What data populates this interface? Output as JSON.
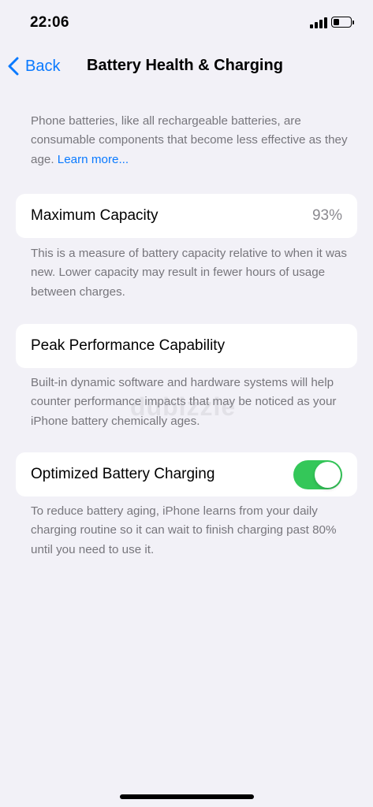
{
  "status": {
    "time": "22:06",
    "battery_level": 0.35
  },
  "nav": {
    "back_label": "Back",
    "title": "Battery Health & Charging"
  },
  "intro": {
    "text": "Phone batteries, like all rechargeable batteries, are consumable components that become less effective as they age. ",
    "link": "Learn more..."
  },
  "max_capacity": {
    "label": "Maximum Capacity",
    "value": "93%",
    "description": "This is a measure of battery capacity relative to when it was new. Lower capacity may result in fewer hours of usage between charges."
  },
  "peak_performance": {
    "label": "Peak Performance Capability",
    "description": "Built-in dynamic software and hardware systems will help counter performance impacts that may be noticed as your iPhone battery chemically ages."
  },
  "optimized_charging": {
    "label": "Optimized Battery Charging",
    "enabled": true,
    "toggle_color": "#34c759",
    "description": "To reduce battery aging, iPhone learns from your daily charging routine so it can wait to finish charging past 80% until you need to use it."
  },
  "watermark": "dubizzle",
  "colors": {
    "accent": "#0a7aff",
    "background": "#f2f1f7",
    "secondary_text": "#77767c"
  }
}
